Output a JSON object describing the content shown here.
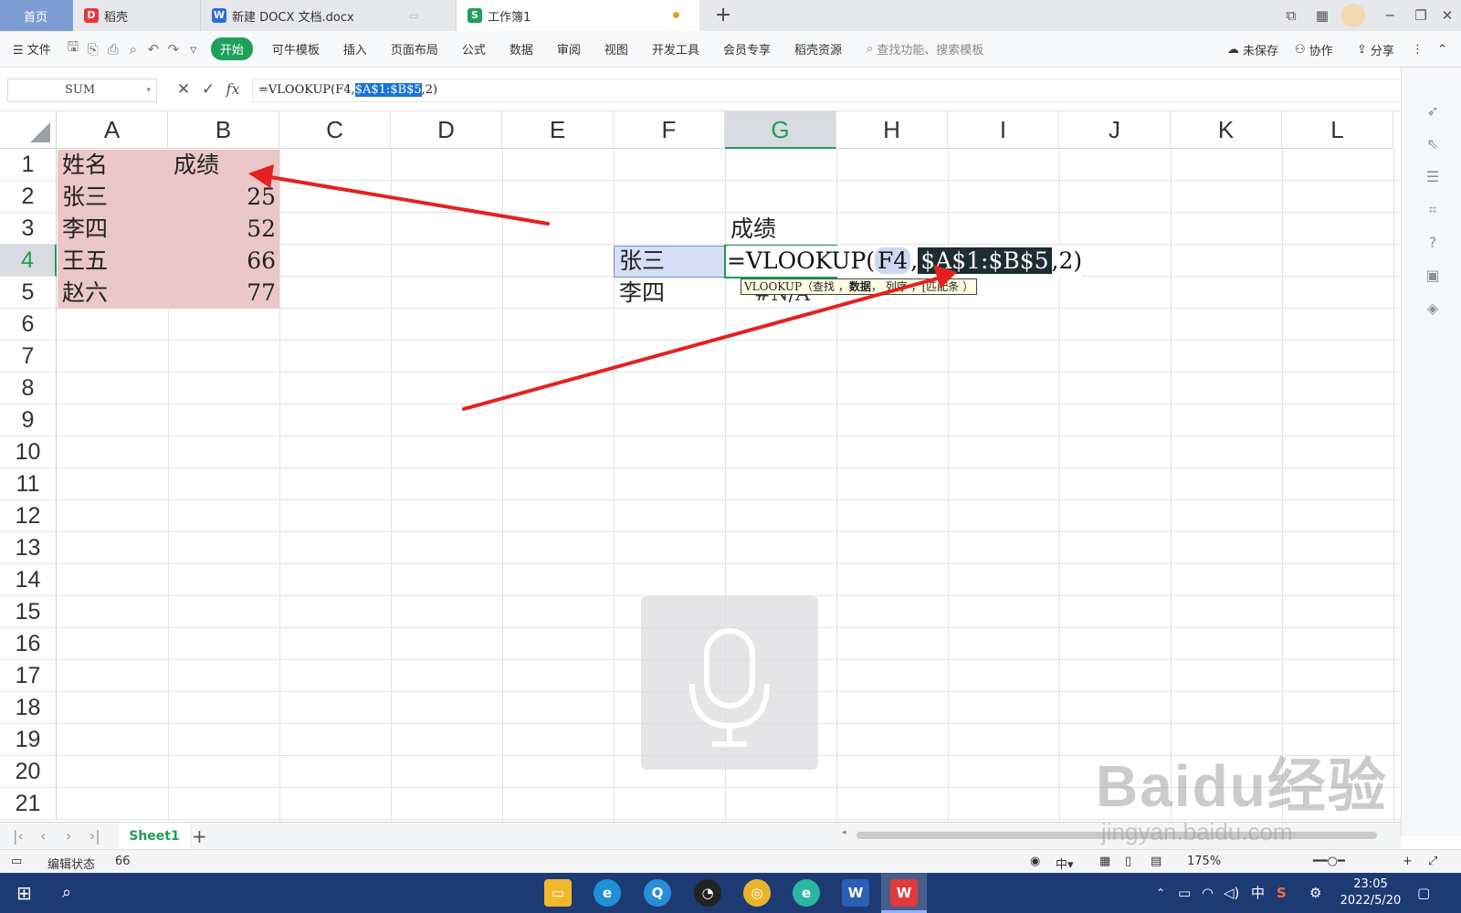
{
  "tabs": {
    "home": "首页",
    "daoke": "稻壳",
    "doc": "新建 DOCX 文档.docx",
    "book": "工作簿1"
  },
  "ribbon": {
    "file": "文件",
    "start": "开始",
    "items": [
      "可牛模板",
      "插入",
      "页面布局",
      "公式",
      "数据",
      "审阅",
      "视图",
      "开发工具",
      "会员专享",
      "稻壳资源"
    ],
    "search_placeholder": "查找功能、搜索模板",
    "unsaved": "未保存",
    "collab": "协作",
    "share": "分享"
  },
  "formula_bar": {
    "name_box": "SUM",
    "formula_prefix": "=VLOOKUP(F4,",
    "formula_selected": "$A$1:$B$5",
    "formula_suffix": ",2)",
    "fx": "fx"
  },
  "columns": [
    "A",
    "B",
    "C",
    "D",
    "E",
    "F",
    "G",
    "H",
    "I",
    "J",
    "K",
    "L"
  ],
  "rows": [
    "1",
    "2",
    "3",
    "4",
    "5",
    "6",
    "7",
    "8",
    "9",
    "10",
    "11",
    "12",
    "13",
    "14",
    "15",
    "16",
    "17",
    "18",
    "19",
    "20",
    "21"
  ],
  "table": {
    "header": [
      "姓名",
      "成绩"
    ],
    "rows": [
      [
        "张三",
        "25"
      ],
      [
        "李四",
        "52"
      ],
      [
        "王五",
        "66"
      ],
      [
        "赵六",
        "77"
      ]
    ]
  },
  "lookup": {
    "g3": "成绩",
    "f4": "张三",
    "f5": "李四",
    "g5_ghost": "#N/A",
    "edit_prefix": "=VLOOKUP(",
    "edit_ref": "F4",
    "edit_comma": ",",
    "edit_range": "$A$1:$B$5",
    "edit_suffix": ",2)"
  },
  "tooltip": {
    "fn": "VLOOKUP（查找",
    "sep1": "，",
    "arg_bold": "数据",
    "sep2": "， 列序",
    "sep3": "，[匹配条",
    "end": "）"
  },
  "sheets": {
    "active": "Sheet1"
  },
  "status": {
    "mode": "编辑状态",
    "value": "66",
    "zoom": "175%"
  },
  "taskbar": {
    "time": "23:05",
    "date": "2022/5/20",
    "ime": "中"
  },
  "watermark": {
    "brand": "Baidu经验",
    "url": "jingyan.baidu.com"
  },
  "colors": {
    "accent": "#1e9e55",
    "selection_pink": "#ebc7c7",
    "arrow": "#e52020"
  }
}
